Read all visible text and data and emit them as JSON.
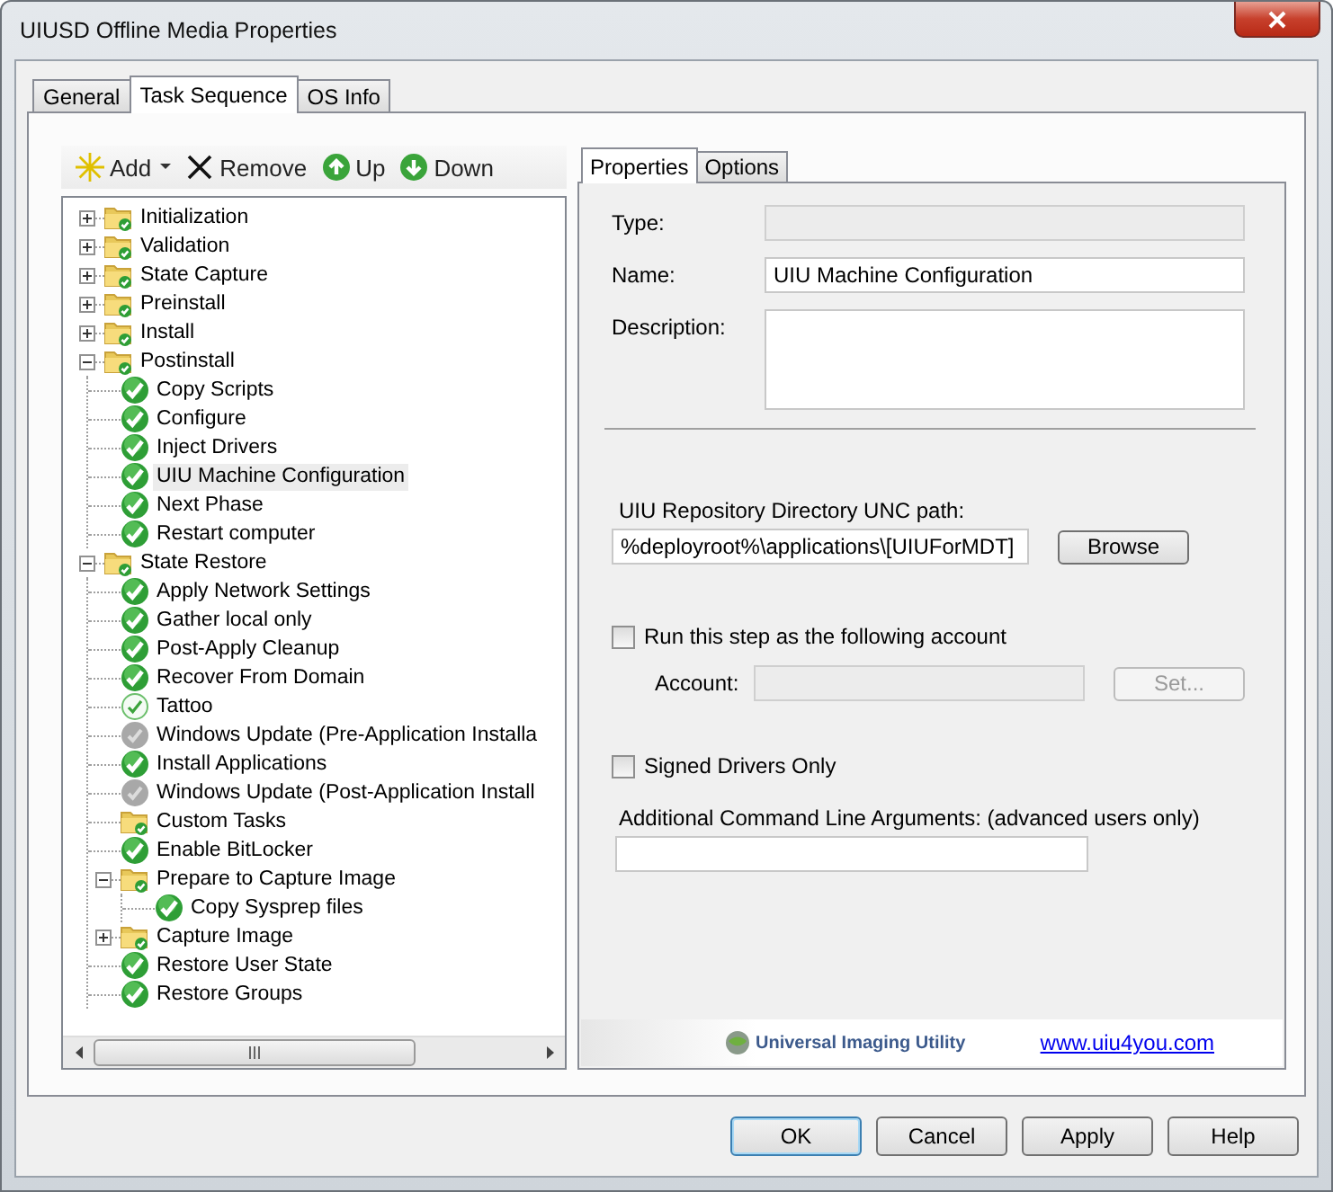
{
  "window": {
    "title": "UIUSD Offline Media Properties"
  },
  "tabs": [
    {
      "label": "General",
      "selected": false
    },
    {
      "label": "Task Sequence",
      "selected": true
    },
    {
      "label": "OS Info",
      "selected": false
    }
  ],
  "toolbar": [
    {
      "label": "Add",
      "kind": "add"
    },
    {
      "label": "Remove",
      "kind": "remove"
    },
    {
      "label": "Up",
      "kind": "up"
    },
    {
      "label": "Down",
      "kind": "down"
    }
  ],
  "tree": [
    {
      "label": "Initialization",
      "kind": "folder",
      "expanded": false,
      "selected": false
    },
    {
      "label": "Validation",
      "kind": "folder",
      "expanded": false,
      "selected": false
    },
    {
      "label": "State Capture",
      "kind": "folder",
      "expanded": false,
      "selected": false
    },
    {
      "label": "Preinstall",
      "kind": "folder",
      "expanded": false,
      "selected": false
    },
    {
      "label": "Install",
      "kind": "folder",
      "expanded": false,
      "selected": false
    },
    {
      "label": "Postinstall",
      "kind": "folder",
      "expanded": true,
      "selected": false,
      "children": [
        {
          "label": "Copy Scripts",
          "kind": "step",
          "selected": false
        },
        {
          "label": "Configure",
          "kind": "step",
          "selected": false
        },
        {
          "label": "Inject Drivers",
          "kind": "step",
          "selected": false
        },
        {
          "label": "UIU Machine Configuration",
          "kind": "step",
          "selected": true
        },
        {
          "label": "Next Phase",
          "kind": "step",
          "selected": false
        },
        {
          "label": "Restart computer",
          "kind": "step",
          "selected": false
        }
      ]
    },
    {
      "label": "State Restore",
      "kind": "folder",
      "expanded": true,
      "selected": false,
      "children": [
        {
          "label": "Apply Network Settings",
          "kind": "step",
          "selected": false
        },
        {
          "label": "Gather local only",
          "kind": "step",
          "selected": false
        },
        {
          "label": "Post-Apply Cleanup",
          "kind": "step",
          "selected": false
        },
        {
          "label": "Recover From Domain",
          "kind": "step",
          "selected": false
        },
        {
          "label": "Tattoo",
          "kind": "step-light",
          "selected": false
        },
        {
          "label": "Windows Update (Pre-Application Installa",
          "kind": "step-grey",
          "selected": false
        },
        {
          "label": "Install Applications",
          "kind": "step",
          "selected": false
        },
        {
          "label": "Windows Update (Post-Application Install",
          "kind": "step-grey",
          "selected": false
        },
        {
          "label": "Custom Tasks",
          "kind": "folder",
          "selected": false
        },
        {
          "label": "Enable BitLocker",
          "kind": "step",
          "selected": false
        },
        {
          "label": "Prepare to Capture Image",
          "kind": "folder",
          "expanded": true,
          "selected": false,
          "children": [
            {
              "label": "Copy Sysprep files",
              "kind": "step",
              "selected": false
            }
          ]
        },
        {
          "label": "Capture Image",
          "kind": "folder",
          "expanded": false,
          "selected": false
        },
        {
          "label": "Restore User State",
          "kind": "step",
          "selected": false
        },
        {
          "label": "Restore Groups",
          "kind": "step",
          "selected": false
        }
      ]
    }
  ],
  "properties_tabs": [
    {
      "label": "Properties",
      "selected": true
    },
    {
      "label": "Options",
      "selected": false
    }
  ],
  "type_field": {
    "label": "Type:",
    "disabled": true
  },
  "name_field": {
    "label": "Name:",
    "value": "UIU Machine Configuration"
  },
  "description_field": {
    "label": "Description:"
  },
  "unc_field": {
    "label": "UIU Repository Directory UNC path:",
    "value": "%deployroot%\\applications\\[UIUForMDT]"
  },
  "browse_button": {
    "label": "Browse"
  },
  "run_as": {
    "label": "Run this step as the following account",
    "checked": false
  },
  "account_field": {
    "label": "Account:",
    "disabled": true
  },
  "set_button": {
    "label": "Set...",
    "disabled": true
  },
  "signed_drivers": {
    "label": "Signed Drivers Only",
    "checked": false
  },
  "arguments_field": {
    "label": "Additional Command Line Arguments: (advanced users only)"
  },
  "footer": {
    "brand": "Universal Imaging Utility",
    "link": "www.uiu4you.com"
  },
  "buttons": [
    {
      "label": "OK",
      "default": true
    },
    {
      "label": "Cancel",
      "default": false
    },
    {
      "label": "Apply",
      "default": false
    },
    {
      "label": "Help",
      "default": false
    }
  ]
}
